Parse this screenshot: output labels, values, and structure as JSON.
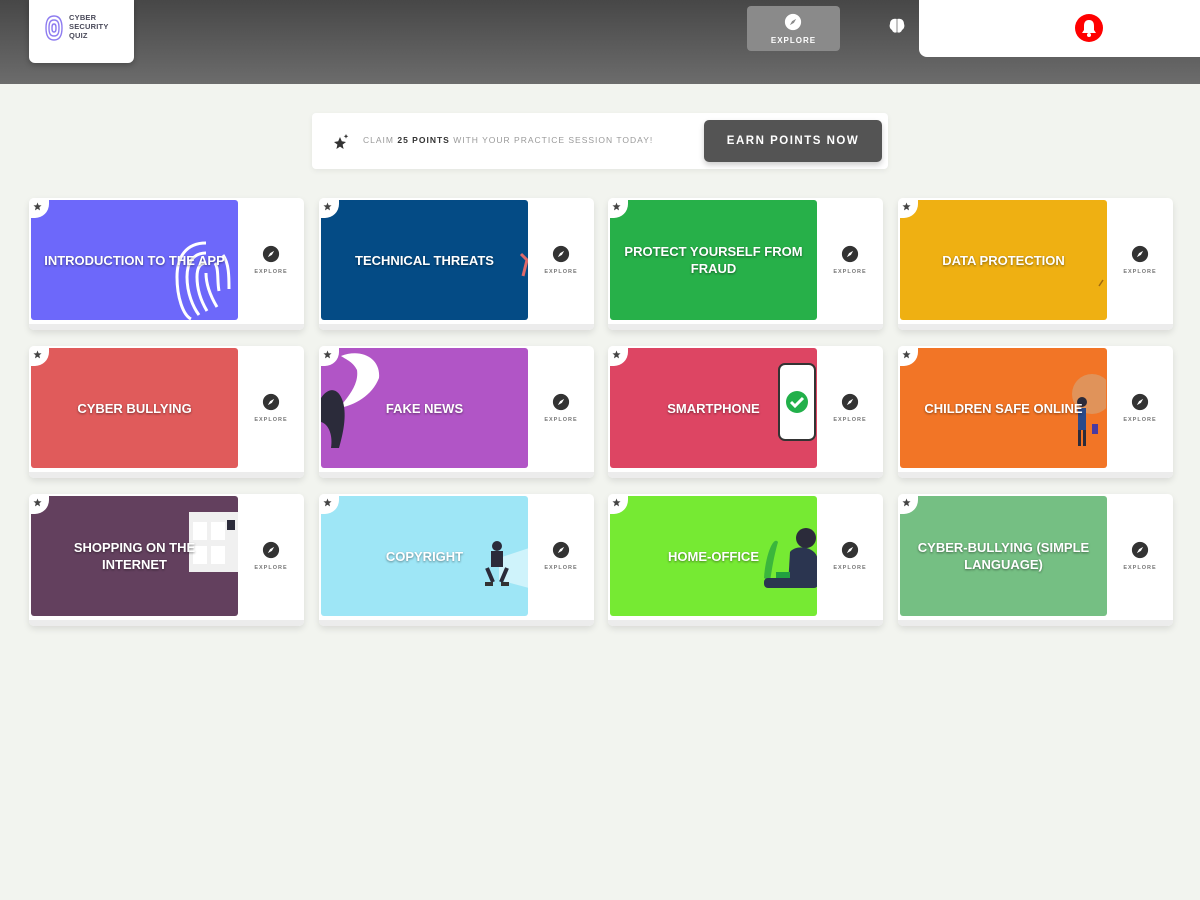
{
  "header": {
    "logo_text": "CYBER SECURITY QUIZ",
    "nav_explore_label": "EXPLORE",
    "icons": [
      "fingerprint-logo-icon",
      "compass-icon",
      "brain-icon",
      "bell-icon"
    ],
    "colors": {
      "header_bg": "#555555",
      "bell": "#ff0000"
    }
  },
  "promo": {
    "text_before": "CLAIM",
    "text_bold": "25 POINTS",
    "text_after": "WITH YOUR PRACTICE SESSION TODAY!",
    "button_label": "EARN POINTS NOW",
    "icon": "star-sparkle-icon"
  },
  "cards": [
    {
      "title": "INTRODUCTION TO THE APP",
      "explore": "EXPLORE",
      "color": "#6d68fa"
    },
    {
      "title": "TECHNICAL THREATS",
      "explore": "EXPLORE",
      "color": "#044b85"
    },
    {
      "title": "PROTECT YOURSELF FROM FRAUD",
      "explore": "EXPLORE",
      "color": "#27b049"
    },
    {
      "title": "DATA PROTECTION",
      "explore": "EXPLORE",
      "color": "#efb012"
    },
    {
      "title": "CYBER BULLYING",
      "explore": "EXPLORE",
      "color": "#e05b5b"
    },
    {
      "title": "FAKE NEWS",
      "explore": "EXPLORE",
      "color": "#b155c6"
    },
    {
      "title": "SMARTPHONE",
      "explore": "EXPLORE",
      "color": "#dd4563"
    },
    {
      "title": "CHILDREN SAFE ONLINE",
      "explore": "EXPLORE",
      "color": "#f27526"
    },
    {
      "title": "SHOPPING ON THE INTERNET",
      "explore": "EXPLORE",
      "color": "#63405e"
    },
    {
      "title": "COPYRIGHT",
      "explore": "EXPLORE",
      "color": "#9ee6f6"
    },
    {
      "title": "HOME-OFFICE",
      "explore": "EXPLORE",
      "color": "#76ea33"
    },
    {
      "title": "CYBER-BULLYING (SIMPLE LANGUAGE)",
      "explore": "EXPLORE",
      "color": "#75bf83"
    }
  ]
}
